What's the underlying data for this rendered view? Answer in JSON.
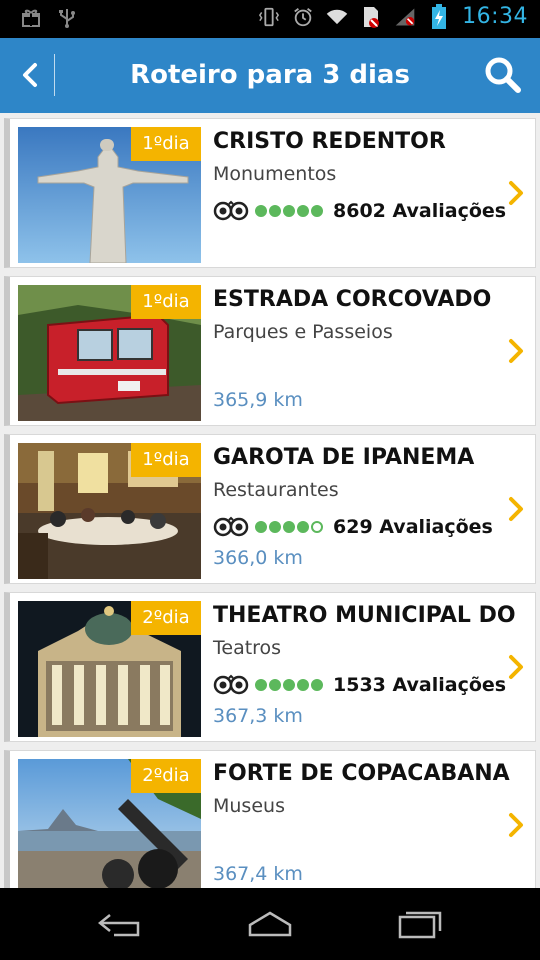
{
  "status_bar": {
    "time": "16:34",
    "left_icons": [
      "gift-icon",
      "usb-icon"
    ],
    "right_icons": [
      "vibrate-icon",
      "alarm-icon",
      "wifi-icon",
      "no-sim-icon",
      "signal-icon",
      "battery-charging-icon"
    ],
    "accent": "#33b5e5"
  },
  "action_bar": {
    "title": "Roteiro para 3 dias",
    "back_icon": "chevron-left-icon",
    "search_icon": "search-icon",
    "color": "#2e86c8"
  },
  "items": [
    {
      "badge": "1ºdia",
      "title": "CRISTO REDENTOR",
      "category": "Monumentos",
      "rating": 5,
      "reviews": "8602 Avaliações",
      "distance": ""
    },
    {
      "badge": "1ºdia",
      "title": "ESTRADA CORCOVADO",
      "category": "Parques e Passeios",
      "rating": null,
      "reviews": "",
      "distance": "365,9 km"
    },
    {
      "badge": "1ºdia",
      "title": "GAROTA DE IPANEMA",
      "category": "Restaurantes",
      "rating": 4,
      "reviews": "629 Avaliações",
      "distance": "366,0 km"
    },
    {
      "badge": "2ºdia",
      "title": "THEATRO MUNICIPAL DO ...",
      "category": "Teatros",
      "rating": 5,
      "reviews": "1533 Avaliações",
      "distance": "367,3 km"
    },
    {
      "badge": "2ºdia",
      "title": "FORTE DE COPACABANA",
      "category": "Museus",
      "rating": null,
      "reviews": "",
      "distance": "367,4 km"
    }
  ],
  "nav_bar": {
    "buttons": [
      "back-nav-icon",
      "home-nav-icon",
      "recents-nav-icon"
    ]
  },
  "colors": {
    "badge": "#f4b400",
    "rating_green": "#5cb85c",
    "distance_blue": "#5a8fc0",
    "chevron": "#f4b400"
  }
}
